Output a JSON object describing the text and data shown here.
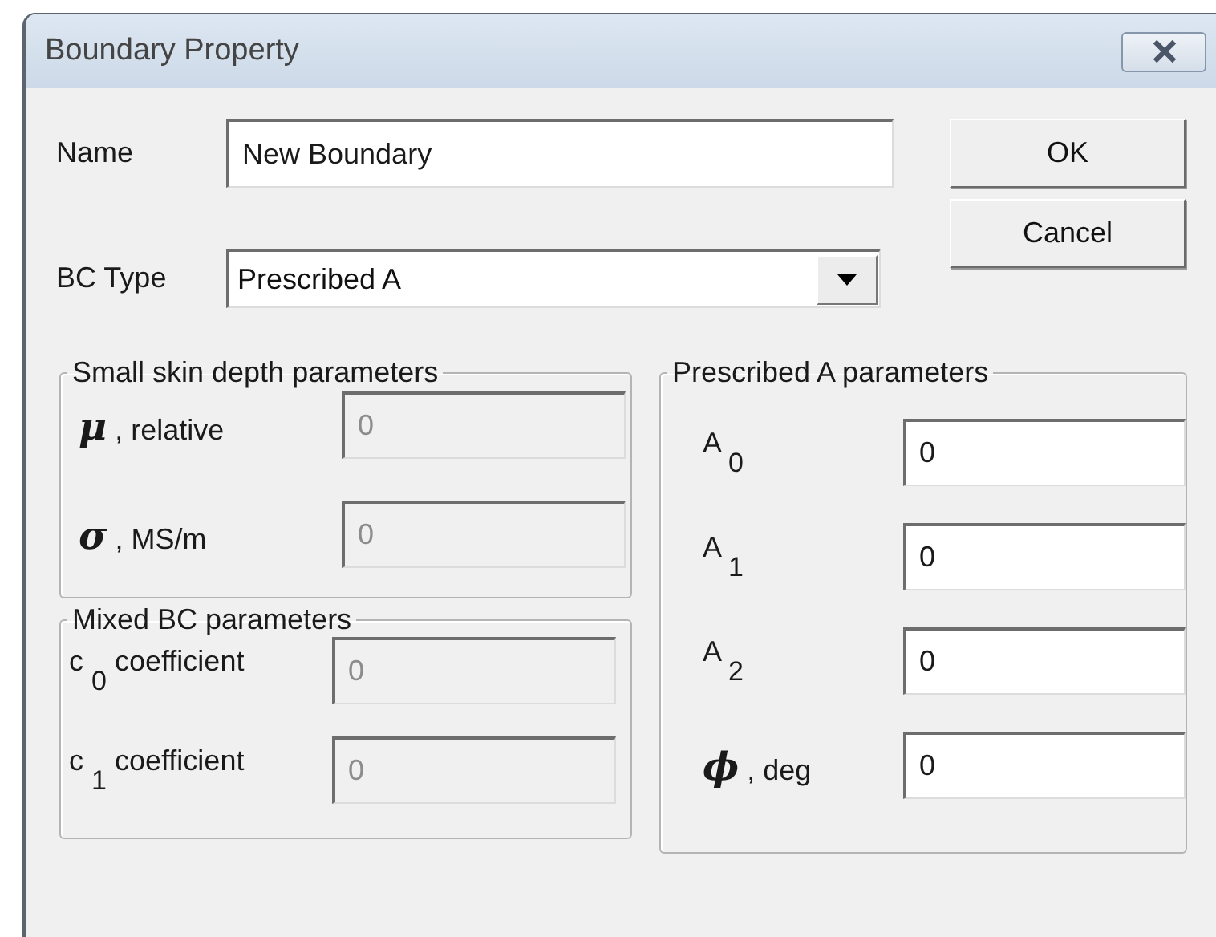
{
  "window": {
    "title": "Boundary Property"
  },
  "name_field": {
    "label": "Name",
    "value": "New Boundary"
  },
  "buttons": [
    {
      "label": "OK"
    },
    {
      "label": "Cancel"
    }
  ],
  "bc_type": {
    "label": "BC Type",
    "value": "Prescribed A"
  },
  "groups": [
    {
      "title": "Small skin depth parameters",
      "fields": [
        {
          "label": "**μ** , relative",
          "value": "0",
          "disabled": true
        },
        {
          "label": "**σ** , MS/m",
          "value": "0",
          "disabled": true
        }
      ]
    },
    {
      "title": "Mixed BC parameters",
      "fields": [
        {
          "label": "c $_{0}$ coefficient",
          "value": "0",
          "disabled": true
        },
        {
          "label": "c $_{1}$ coefficient",
          "value": "0",
          "disabled": true
        }
      ]
    },
    {
      "title": "Prescribed A parameters",
      "fields": [
        {
          "label": "A $_{0}$",
          "value": "0",
          "disabled": false
        },
        {
          "label": "A $_{1}$",
          "value": "0",
          "disabled": false
        },
        {
          "label": "A $_{2}$",
          "value": "0",
          "disabled": false
        },
        {
          "label": "**ϕ** , deg",
          "value": "0",
          "disabled": false
        }
      ]
    }
  ]
}
